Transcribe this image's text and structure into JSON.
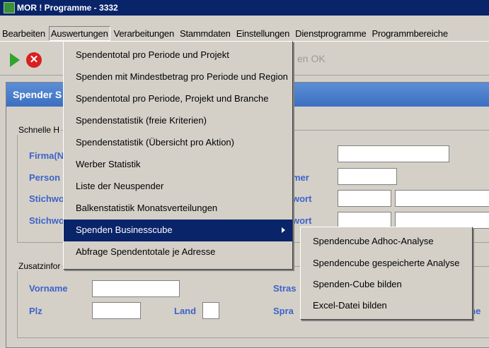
{
  "window": {
    "title": "MOR ! Programme - 3332"
  },
  "menubar": {
    "items": [
      {
        "label": "Bearbeiten"
      },
      {
        "label": "Auswertungen"
      },
      {
        "label": "Verarbeitungen"
      },
      {
        "label": "Stammdaten"
      },
      {
        "label": "Einstellungen"
      },
      {
        "label": "Dienstprogramme"
      },
      {
        "label": "Programmbereiche"
      }
    ]
  },
  "toolbar": {
    "ok_label": "en OK",
    "play_icon": "play-icon",
    "cancel_icon": "cancel-icon"
  },
  "panel": {
    "title": "Spender S"
  },
  "form": {
    "group1_label": "Schnelle H",
    "group2_label": "Zusatzinfor",
    "labels": {
      "firma": "Firma(Na",
      "person": "Person",
      "stichwort1": "Stichwo",
      "stichwort2": "Stichwo",
      "nummer": "mer",
      "wort1": "wort",
      "wort2": "wort",
      "vorname": "Vorname",
      "plz": "Plz",
      "land": "Land",
      "strasse": "Stras",
      "sprache": "Spra",
      "suche": "che"
    }
  },
  "dropdown": {
    "items": [
      {
        "label": "Spendentotal pro Periode und Projekt"
      },
      {
        "label": "Spenden mit Mindestbetrag pro Periode und Region"
      },
      {
        "label": "Spendentotal pro Periode, Projekt und Branche"
      },
      {
        "label": "Spendenstatistik (freie Kriterien)"
      },
      {
        "label": "Spendenstatistik (Übersicht pro Aktion)"
      },
      {
        "label": "Werber Statistik"
      },
      {
        "label": "Liste der Neuspender"
      },
      {
        "label": "Balkenstatistik Monatsverteilungen"
      },
      {
        "label": "Spenden Businesscube"
      },
      {
        "label": "Abfrage Spendentotale je Adresse"
      }
    ]
  },
  "submenu": {
    "items": [
      {
        "label": "Spendencube Adhoc-Analyse"
      },
      {
        "label": "Spendencube gespeicherte Analyse"
      },
      {
        "label": "Spenden-Cube bilden"
      },
      {
        "label": "Excel-Datei bilden"
      }
    ]
  },
  "colors": {
    "titlebar": "#0a246a",
    "highlight": "#0a246a",
    "panel_header": "#4a7fd0",
    "label_blue": "#3d63c9"
  }
}
